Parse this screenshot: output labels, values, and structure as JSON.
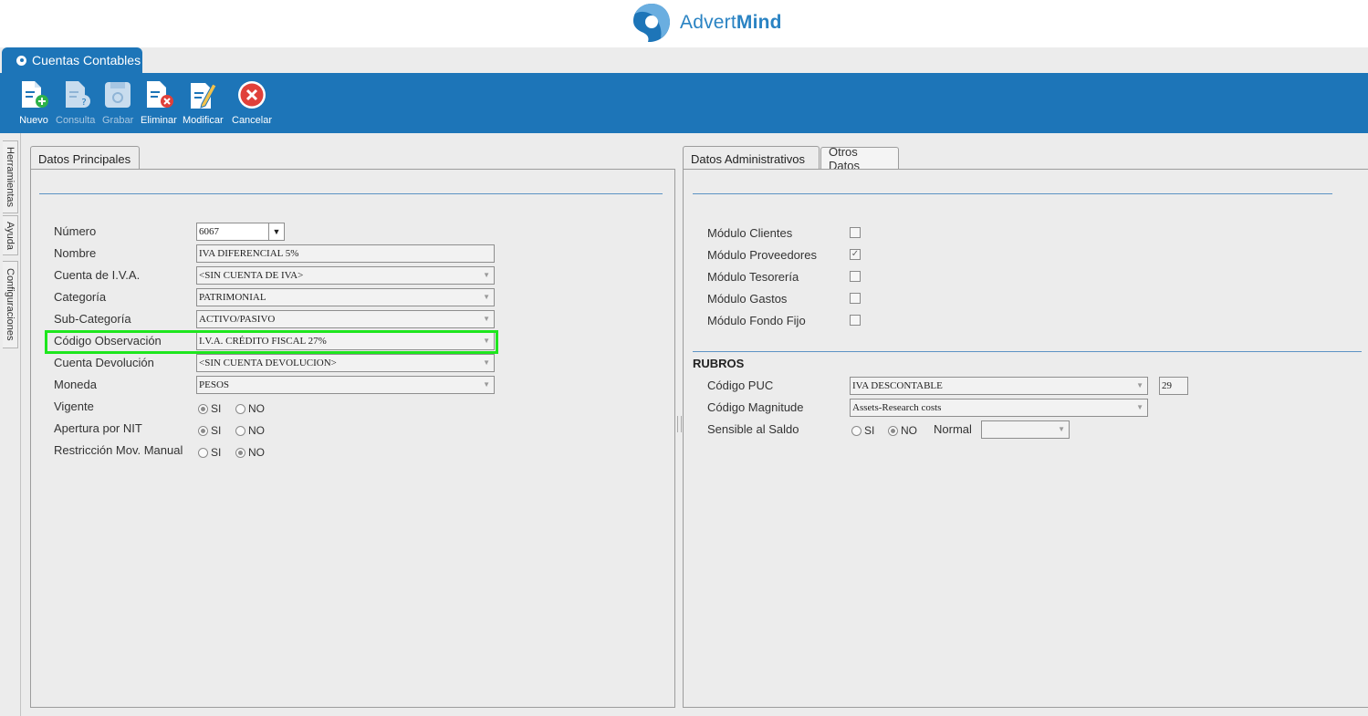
{
  "brand": {
    "name_plain": "Advert",
    "name_bold": "Mind"
  },
  "app_tab": {
    "label": "Cuentas Contables"
  },
  "toolbar": {
    "nuevo": "Nuevo",
    "consulta": "Consulta",
    "grabar": "Grabar",
    "eliminar": "Eliminar",
    "modificar": "Modificar",
    "cancelar": "Cancelar"
  },
  "side_tabs": {
    "herramientas": "Herramientas",
    "ayuda": "Ayuda",
    "configuraciones": "Configuraciones"
  },
  "left_panel": {
    "tab": "Datos Principales",
    "numero": {
      "label": "Número",
      "value": "6067"
    },
    "nombre": {
      "label": "Nombre",
      "value": "IVA DIFERENCIAL 5%"
    },
    "cuenta_iva": {
      "label": "Cuenta de I.V.A.",
      "value": "<SIN CUENTA DE IVA>"
    },
    "categoria": {
      "label": "Categoría",
      "value": "PATRIMONIAL"
    },
    "subcategoria": {
      "label": "Sub-Categoría",
      "value": "ACTIVO/PASIVO"
    },
    "codigo_obs": {
      "label": "Código Observación",
      "value": "I.V.A. CRÉDITO FISCAL 27%"
    },
    "cuenta_dev": {
      "label": "Cuenta Devolución",
      "value": "<SIN CUENTA DEVOLUCION>"
    },
    "moneda": {
      "label": "Moneda",
      "value": "PESOS"
    },
    "vigente": {
      "label": "Vigente",
      "selected": "SI"
    },
    "apertura_nit": {
      "label": "Apertura por NIT",
      "selected": "SI"
    },
    "restriccion": {
      "label": "Restricción Mov. Manual",
      "selected": "NO"
    },
    "si": "SI",
    "no": "NO"
  },
  "right_panel": {
    "tab_active": "Datos Administrativos",
    "tab_other": "Otros Datos",
    "modulos": [
      {
        "label": "Módulo Clientes",
        "checked": false
      },
      {
        "label": "Módulo Proveedores",
        "checked": true
      },
      {
        "label": "Módulo Tesorería",
        "checked": false
      },
      {
        "label": "Módulo Gastos",
        "checked": false
      },
      {
        "label": "Módulo Fondo Fijo",
        "checked": false
      }
    ],
    "rubros": "RUBROS",
    "codigo_puc": {
      "label": "Código PUC",
      "value": "IVA DESCONTABLE",
      "code": "29"
    },
    "codigo_magnitud": {
      "label": "Código Magnitude",
      "value": "Assets-Research costs"
    },
    "sensible": {
      "label": "Sensible al Saldo",
      "selected": "NO",
      "normal_label": "Normal",
      "normal_value": ""
    },
    "si": "SI",
    "no": "NO"
  },
  "colors": {
    "accent": "#1d75b8",
    "highlight": "#1ee61e"
  }
}
